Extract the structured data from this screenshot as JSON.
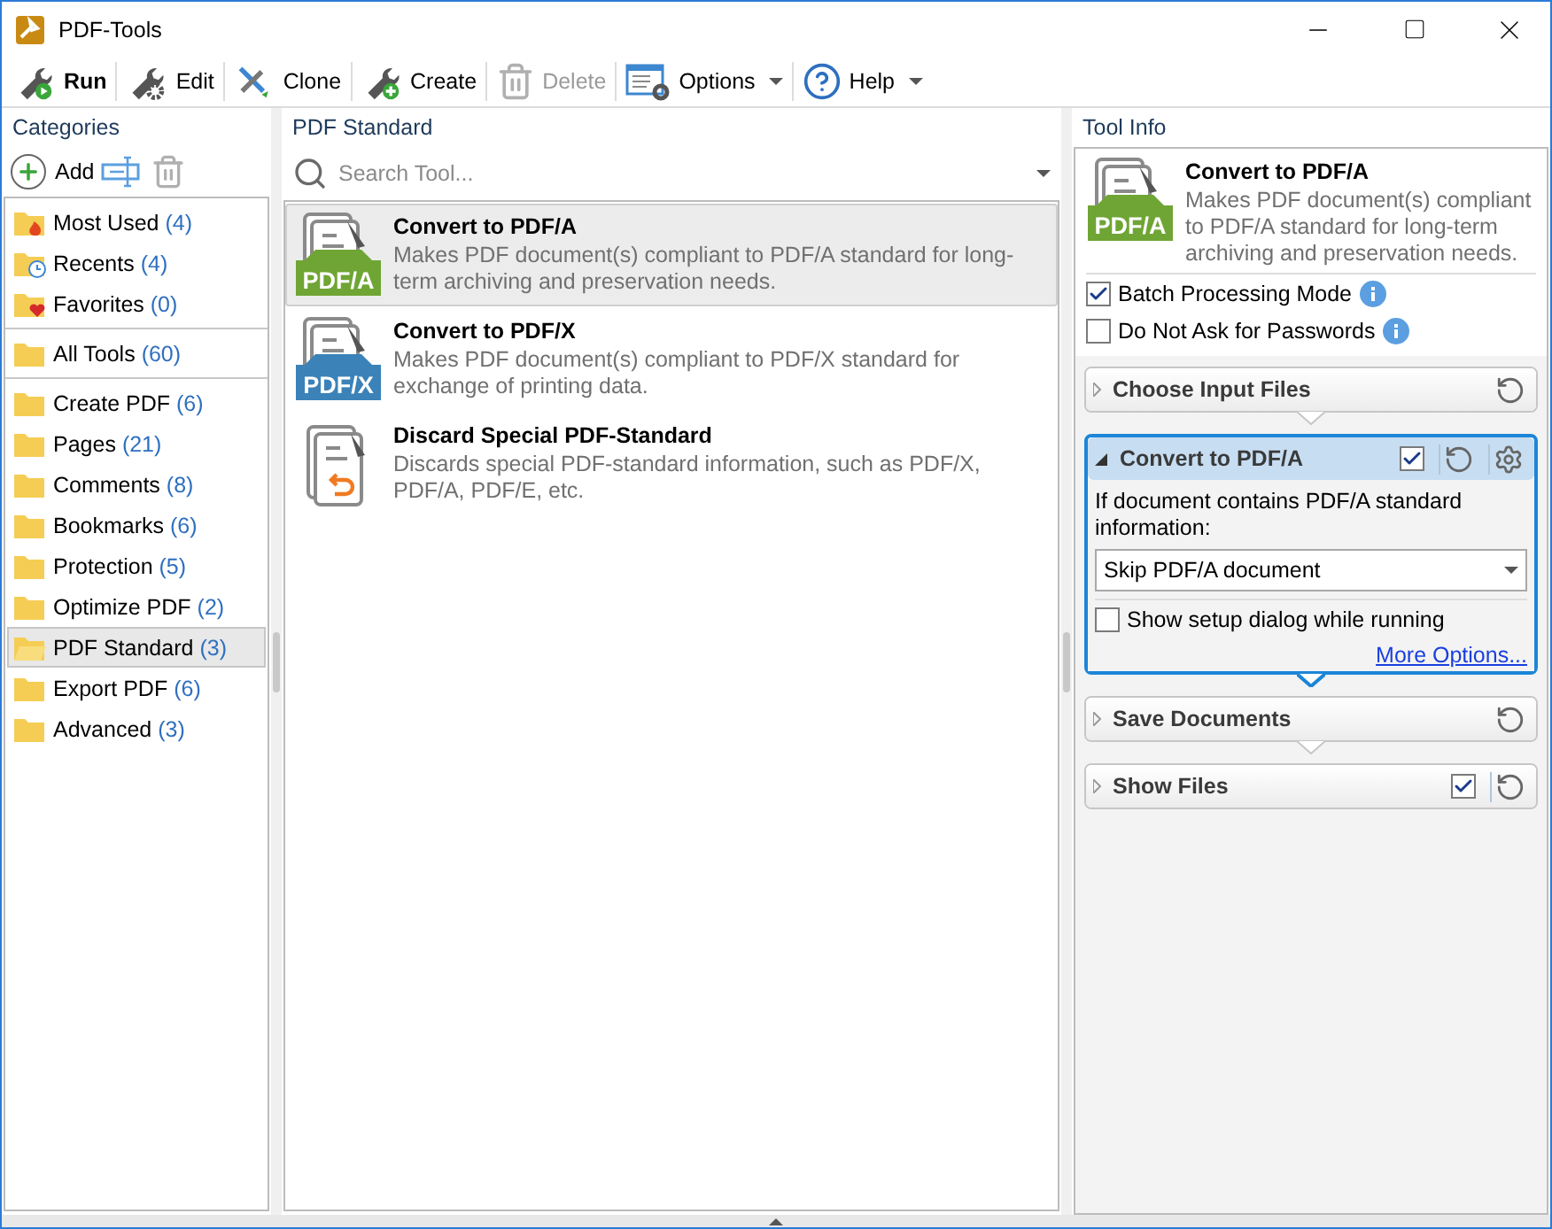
{
  "window": {
    "title": "PDF-Tools"
  },
  "toolbar": [
    {
      "kind": "run",
      "label": "Run",
      "disabled": false,
      "dropdown": false
    },
    {
      "kind": "edit",
      "label": "Edit",
      "disabled": false,
      "dropdown": false
    },
    {
      "kind": "clone",
      "label": "Clone",
      "disabled": false,
      "dropdown": false
    },
    {
      "kind": "create",
      "label": "Create",
      "disabled": false,
      "dropdown": false
    },
    {
      "kind": "delete",
      "label": "Delete",
      "disabled": true,
      "dropdown": false
    },
    {
      "kind": "options",
      "label": "Options",
      "disabled": false,
      "dropdown": true
    },
    {
      "kind": "help",
      "label": "Help",
      "disabled": false,
      "dropdown": true
    }
  ],
  "categories": {
    "title": "Categories",
    "add_label": "Add",
    "groups": [
      [
        {
          "kind": "most-used",
          "name": "Most Used",
          "count": "(4)",
          "selected": false
        },
        {
          "kind": "recents",
          "name": "Recents",
          "count": "(4)",
          "selected": false
        },
        {
          "kind": "favorites",
          "name": "Favorites",
          "count": "(0)",
          "selected": false
        }
      ],
      [
        {
          "kind": "folder",
          "name": "All Tools",
          "count": "(60)",
          "selected": false
        }
      ],
      [
        {
          "kind": "folder",
          "name": "Create PDF",
          "count": "(6)",
          "selected": false
        },
        {
          "kind": "folder",
          "name": "Pages",
          "count": "(21)",
          "selected": false
        },
        {
          "kind": "folder",
          "name": "Comments",
          "count": "(8)",
          "selected": false
        },
        {
          "kind": "folder",
          "name": "Bookmarks",
          "count": "(6)",
          "selected": false
        },
        {
          "kind": "folder",
          "name": "Protection",
          "count": "(5)",
          "selected": false
        },
        {
          "kind": "folder",
          "name": "Optimize PDF",
          "count": "(2)",
          "selected": false
        },
        {
          "kind": "open-folder",
          "name": "PDF Standard",
          "count": "(3)",
          "selected": true
        },
        {
          "kind": "folder",
          "name": "Export PDF",
          "count": "(6)",
          "selected": false
        },
        {
          "kind": "folder",
          "name": "Advanced",
          "count": "(3)",
          "selected": false
        }
      ]
    ]
  },
  "tools": {
    "title": "PDF Standard",
    "search": {
      "placeholder": "Search Tool..."
    },
    "items": [
      {
        "kind": "badge",
        "badge": "PDF/A",
        "color": "#6fa534",
        "name": "Convert to PDF/A",
        "description": "Makes PDF document(s) compliant to PDF/A standard for long-term archiving and preservation needs.",
        "selected": true
      },
      {
        "kind": "badge",
        "badge": "PDF/X",
        "color": "#3b82b8",
        "name": "Convert to PDF/X",
        "description": "Makes PDF document(s) compliant to PDF/X standard for exchange of printing data.",
        "selected": false
      },
      {
        "kind": "discard",
        "name": "Discard Special PDF-Standard",
        "description": "Discards special PDF-standard information, such as PDF/X, PDF/A, PDF/E, etc.",
        "selected": false
      }
    ]
  },
  "tool_info": {
    "title": "Tool Info",
    "tool": {
      "badge": "PDF/A",
      "color": "#6fa534",
      "name": "Convert to PDF/A",
      "description": "Makes PDF document(s) compliant to PDF/A standard for long-term archiving and preservation needs."
    },
    "options": [
      {
        "label": "Batch Processing Mode",
        "checked": true
      },
      {
        "label": "Do Not Ask for Passwords",
        "checked": false
      }
    ],
    "steps": [
      {
        "kind": "plain",
        "title": "Choose Input Files",
        "expanded": false
      },
      {
        "kind": "checkable",
        "title": "Convert to PDF/A",
        "expanded": true,
        "checked": true,
        "settings": true,
        "prompt": "If document contains PDF/A standard information:",
        "choice": "Skip PDF/A document",
        "setup_dialog": {
          "label": "Show setup dialog while running",
          "checked": false
        },
        "link": "More Options..."
      },
      {
        "kind": "plain",
        "title": "Save Documents",
        "expanded": false
      },
      {
        "kind": "checkable",
        "title": "Show Files",
        "expanded": false,
        "checked": true
      }
    ]
  }
}
